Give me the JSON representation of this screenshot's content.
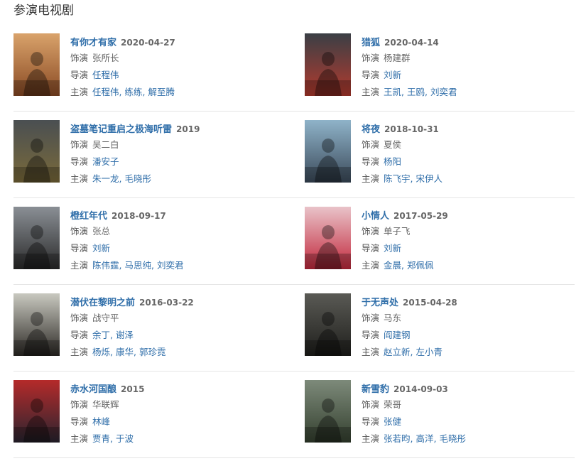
{
  "section_title": "参演电视剧",
  "labels": {
    "role": "饰演",
    "director": "导演",
    "starring": "主演"
  },
  "shows": [
    {
      "title": "有你才有家",
      "date": "2020-04-27",
      "role": "张所长",
      "directors": [
        "任程伟"
      ],
      "stars": [
        "任程伟",
        "练练",
        "解至腾"
      ],
      "poster_colors": [
        "#d9a36b",
        "#8a4a24"
      ]
    },
    {
      "title": "猎狐",
      "date": "2020-04-14",
      "role": "杨建群",
      "directors": [
        "刘新"
      ],
      "stars": [
        "王凯",
        "王鸥",
        "刘奕君"
      ],
      "poster_colors": [
        "#3a3f45",
        "#b33a2e"
      ]
    },
    {
      "title": "盗墓笔记重启之极海听雷",
      "date": "2019",
      "role": "吴二白",
      "directors": [
        "潘安子"
      ],
      "stars": [
        "朱一龙",
        "毛晓彤"
      ],
      "poster_colors": [
        "#4a4f52",
        "#7a6a3a"
      ]
    },
    {
      "title": "将夜",
      "date": "2018-10-31",
      "role": "夏侯",
      "directors": [
        "杨阳"
      ],
      "stars": [
        "陈飞宇",
        "宋伊人"
      ],
      "poster_colors": [
        "#8fb3c9",
        "#3b4a5a"
      ]
    },
    {
      "title": "橙红年代",
      "date": "2018-09-17",
      "role": "张总",
      "directors": [
        "刘新"
      ],
      "stars": [
        "陈伟霆",
        "马思纯",
        "刘奕君"
      ],
      "poster_colors": [
        "#8a8f95",
        "#2b2b2b"
      ]
    },
    {
      "title": "小情人",
      "date": "2017-05-29",
      "role": "单子飞",
      "directors": [
        "刘新"
      ],
      "stars": [
        "金晨",
        "郑佩佩"
      ],
      "poster_colors": [
        "#e9c3c9",
        "#c2283c"
      ]
    },
    {
      "title": "潜伏在黎明之前",
      "date": "2016-03-22",
      "role": "战守平",
      "directors": [
        "余丁",
        "谢泽"
      ],
      "stars": [
        "杨烁",
        "康华",
        "郭珍霓"
      ],
      "poster_colors": [
        "#c9c9c0",
        "#2d2a26"
      ]
    },
    {
      "title": "于无声处",
      "date": "2015-04-28",
      "role": "马东",
      "directors": [
        "阎建钢"
      ],
      "stars": [
        "赵立新",
        "左小青"
      ],
      "poster_colors": [
        "#5a5a55",
        "#1f1f1c"
      ]
    },
    {
      "title": "赤水河国酿",
      "date": "2015",
      "role": "华联辉",
      "directors": [
        "林峰"
      ],
      "stars": [
        "贾青",
        "于波"
      ],
      "poster_colors": [
        "#b52a2a",
        "#2a2530"
      ]
    },
    {
      "title": "新雪豹",
      "date": "2014-09-03",
      "role": "荣哥",
      "directors": [
        "张健"
      ],
      "stars": [
        "张若昀",
        "高洋",
        "毛晓彤"
      ],
      "poster_colors": [
        "#7d8a7a",
        "#34402f"
      ]
    }
  ]
}
